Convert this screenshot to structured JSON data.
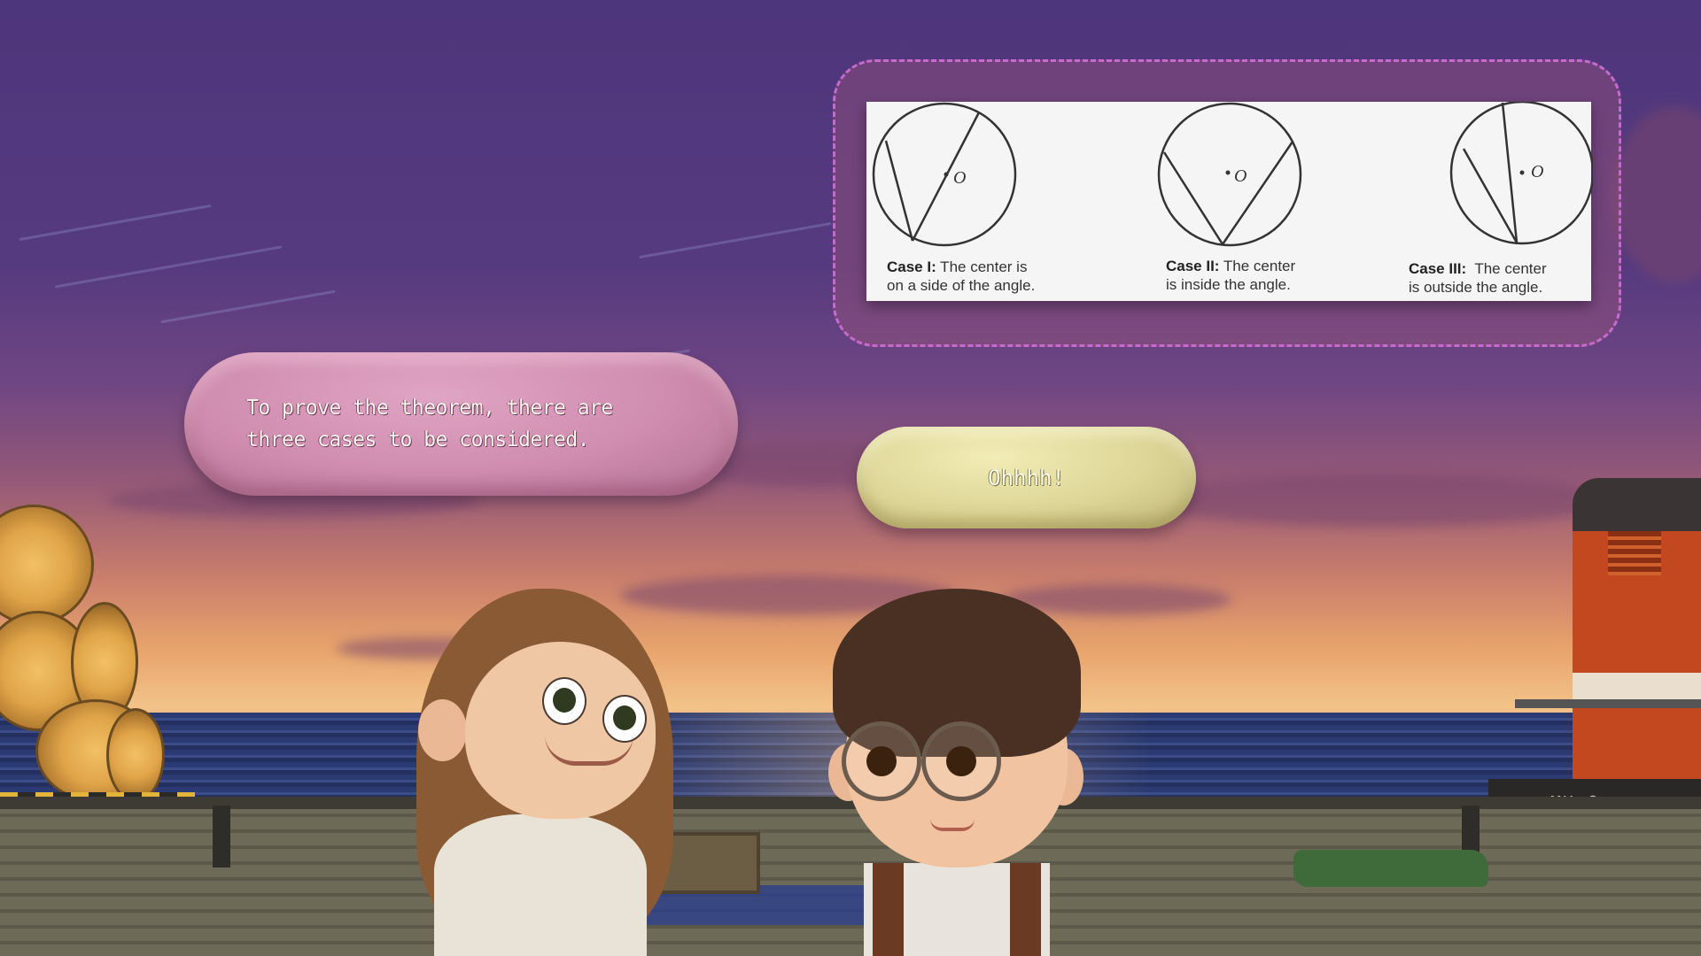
{
  "dialogue": {
    "girl_line": "To prove the theorem, there are three cases to be considered.",
    "boy_line": "Ohhhh!"
  },
  "diagram": {
    "cases": [
      {
        "title": "Case I",
        "suffix": ":",
        "line1": " The center is",
        "line2": "on a side of the angle.",
        "center_label": "O"
      },
      {
        "title": "Case II:",
        "suffix": "",
        "line1": " The center",
        "line2": "is inside the angle.",
        "center_label": "O"
      },
      {
        "title": "Case III:",
        "suffix": "",
        "line1": "  The center",
        "line2": "is outside the angle.",
        "center_label": "O"
      }
    ]
  },
  "scene": {
    "train_id": "MH-8"
  },
  "colors": {
    "girl_bubble": "#cf8caf",
    "boy_bubble": "#ddd596",
    "diagram_frame": "#c76ad0"
  }
}
